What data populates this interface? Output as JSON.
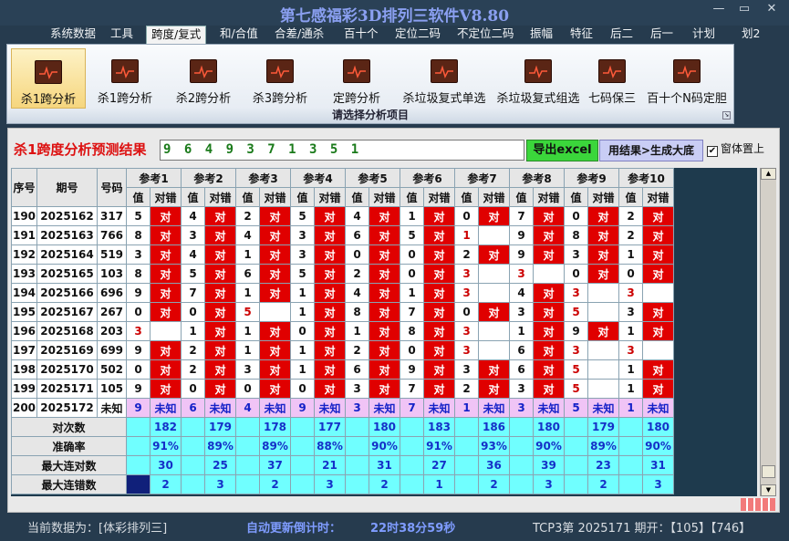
{
  "window": {
    "title": "第七感福彩3D排列三软件V8.80",
    "min_label": "—",
    "max_label": "▭",
    "close_label": "✕"
  },
  "menu": [
    {
      "label": "系统数据",
      "active": false
    },
    {
      "label": "工具",
      "active": false
    },
    {
      "label": "跨度/复式",
      "active": true
    },
    {
      "label": "和/合值",
      "active": false
    },
    {
      "label": "合差/通杀",
      "active": false
    },
    {
      "label": "百十个",
      "active": false
    },
    {
      "label": "定位二码",
      "active": false
    },
    {
      "label": "不定位二码",
      "active": false
    },
    {
      "label": "振幅",
      "active": false
    },
    {
      "label": "特征",
      "active": false
    },
    {
      "label": "后二",
      "active": false
    },
    {
      "label": "后一",
      "active": false
    },
    {
      "label": "计划",
      "active": false
    },
    {
      "label": "划2",
      "active": false
    }
  ],
  "ribbon": {
    "caption": "请选择分析项目",
    "buttons": [
      {
        "label": "杀1跨分析",
        "active": true
      },
      {
        "label": "杀1跨分析",
        "active": false
      },
      {
        "label": "杀2跨分析",
        "active": false
      },
      {
        "label": "杀3跨分析",
        "active": false
      },
      {
        "label": "定跨分析",
        "active": false
      },
      {
        "label": "杀垃圾复式单选",
        "active": false
      },
      {
        "label": "杀垃圾复式组选",
        "active": false
      },
      {
        "label": "七码保三",
        "active": false
      },
      {
        "label": "百十个N码定胆",
        "active": false
      }
    ]
  },
  "panel": {
    "title": "杀1跨度分析预测结果",
    "result_value": "9 6 4 9 3 7 1 3 5 1",
    "export_label": "导出excel",
    "generate_label": "用结果>生成大底",
    "pin_label": "窗体置上",
    "pin_checked": true
  },
  "table": {
    "head_seq": "序号",
    "head_period": "期号",
    "head_num": "号码",
    "groups": [
      "参考1",
      "参考2",
      "参考3",
      "参考4",
      "参考5",
      "参考6",
      "参考7",
      "参考8",
      "参考9",
      "参考10"
    ],
    "sub_val": "值",
    "sub_ok": "对错",
    "rows": [
      {
        "seq": "190",
        "period": "2025162",
        "num": "317",
        "vals": [
          "5",
          "4",
          "2",
          "5",
          "4",
          "1",
          "0",
          "7",
          "0",
          "2"
        ],
        "res": [
          "对",
          "对",
          "对",
          "对",
          "对",
          "对",
          "对",
          "对",
          "对",
          "对"
        ]
      },
      {
        "seq": "191",
        "period": "2025163",
        "num": "766",
        "vals": [
          "8",
          "3",
          "4",
          "3",
          "6",
          "5",
          "1",
          "9",
          "8",
          "2"
        ],
        "res": [
          "对",
          "对",
          "对",
          "对",
          "对",
          "对",
          "",
          "对",
          "对",
          "对"
        ]
      },
      {
        "seq": "192",
        "period": "2025164",
        "num": "519",
        "vals": [
          "3",
          "4",
          "1",
          "3",
          "0",
          "0",
          "2",
          "9",
          "3",
          "1"
        ],
        "res": [
          "对",
          "对",
          "对",
          "对",
          "对",
          "对",
          "对",
          "对",
          "对",
          "对"
        ]
      },
      {
        "seq": "193",
        "period": "2025165",
        "num": "103",
        "vals": [
          "8",
          "5",
          "6",
          "5",
          "2",
          "0",
          "3",
          "3",
          "0",
          "0"
        ],
        "res": [
          "对",
          "对",
          "对",
          "对",
          "对",
          "对",
          "",
          "",
          "对",
          "对"
        ]
      },
      {
        "seq": "194",
        "period": "2025166",
        "num": "696",
        "vals": [
          "9",
          "7",
          "1",
          "1",
          "4",
          "1",
          "3",
          "4",
          "3",
          "3"
        ],
        "res": [
          "对",
          "对",
          "对",
          "对",
          "对",
          "对",
          "",
          "对",
          "",
          ""
        ]
      },
      {
        "seq": "195",
        "period": "2025167",
        "num": "267",
        "vals": [
          "0",
          "0",
          "5",
          "1",
          "8",
          "7",
          "0",
          "3",
          "5",
          "3"
        ],
        "res": [
          "对",
          "对",
          "",
          "对",
          "对",
          "对",
          "对",
          "对",
          "",
          "对"
        ]
      },
      {
        "seq": "196",
        "period": "2025168",
        "num": "203",
        "vals": [
          "3",
          "1",
          "1",
          "0",
          "1",
          "8",
          "3",
          "1",
          "9",
          "1"
        ],
        "res": [
          "",
          "对",
          "对",
          "对",
          "对",
          "对",
          "",
          "对",
          "对",
          "对"
        ]
      },
      {
        "seq": "197",
        "period": "2025169",
        "num": "699",
        "vals": [
          "9",
          "2",
          "1",
          "1",
          "2",
          "0",
          "3",
          "6",
          "3",
          "3"
        ],
        "res": [
          "对",
          "对",
          "对",
          "对",
          "对",
          "对",
          "",
          "对",
          "",
          ""
        ]
      },
      {
        "seq": "198",
        "period": "2025170",
        "num": "502",
        "vals": [
          "0",
          "2",
          "3",
          "1",
          "6",
          "9",
          "3",
          "6",
          "5",
          "1"
        ],
        "res": [
          "对",
          "对",
          "对",
          "对",
          "对",
          "对",
          "对",
          "对",
          "",
          "对"
        ]
      },
      {
        "seq": "199",
        "period": "2025171",
        "num": "105",
        "vals": [
          "9",
          "0",
          "0",
          "0",
          "3",
          "7",
          "2",
          "3",
          "5",
          "1"
        ],
        "res": [
          "对",
          "对",
          "对",
          "对",
          "对",
          "对",
          "对",
          "对",
          "",
          "对"
        ]
      }
    ],
    "pending": {
      "seq": "200",
      "period": "2025172",
      "num": "未知",
      "vals": [
        "9",
        "6",
        "4",
        "9",
        "3",
        "7",
        "1",
        "3",
        "5",
        "1"
      ],
      "res_label": "未知"
    },
    "summary": [
      {
        "label": "对次数",
        "vals": [
          "182",
          "179",
          "178",
          "177",
          "180",
          "183",
          "186",
          "180",
          "179",
          "180"
        ]
      },
      {
        "label": "准确率",
        "vals": [
          "91%",
          "89%",
          "89%",
          "88%",
          "90%",
          "91%",
          "93%",
          "90%",
          "89%",
          "90%"
        ]
      },
      {
        "label": "最大连对数",
        "vals": [
          "30",
          "25",
          "37",
          "21",
          "31",
          "27",
          "36",
          "39",
          "23",
          "31"
        ]
      },
      {
        "label": "最大连错数",
        "vals": [
          "2",
          "3",
          "2",
          "3",
          "2",
          "1",
          "2",
          "3",
          "2",
          "3"
        ]
      }
    ]
  },
  "status": {
    "current_data": "当前数据为：[体彩排列三]",
    "countdown_label": "自动更新倒计时：",
    "countdown_value": "22时38分59秒",
    "tcp_text": "TCP3第 2025171 期开：【105】【746】"
  },
  "colors": {
    "correct_bg": "#e00000",
    "miss_text": "#c00000",
    "unknown_bg": "#f0c4f6",
    "summary_bg": "#70ffff",
    "summary_text": "#1530c8",
    "title_red": "#d11111",
    "result_green": "#1a7a1a"
  }
}
